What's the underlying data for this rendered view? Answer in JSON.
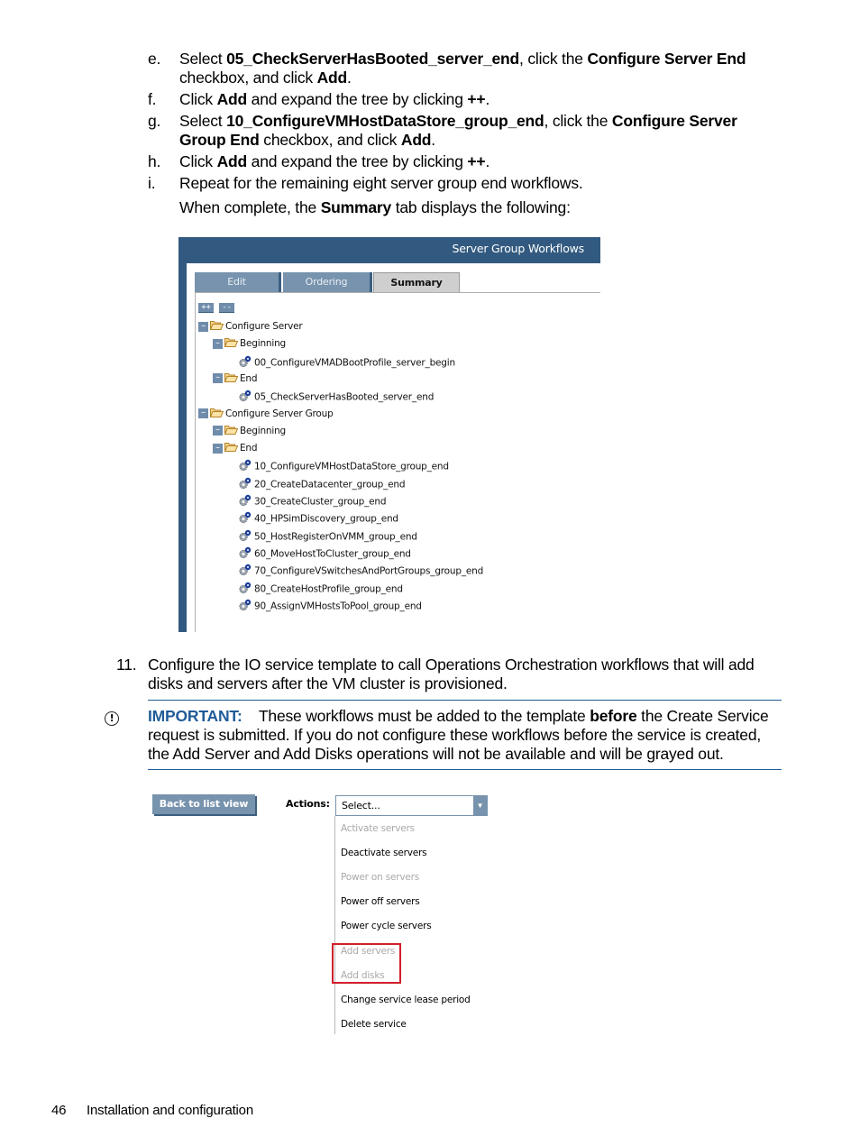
{
  "steps_top": [
    {
      "label": "e.",
      "parts": [
        [
          "Select ",
          false
        ],
        [
          "05_CheckServerHasBooted_server_end",
          true
        ],
        [
          ", click the ",
          false
        ],
        [
          "Configure Server End",
          true
        ],
        [
          "  checkbox, and click ",
          false
        ],
        [
          "Add",
          true
        ],
        [
          ".",
          false
        ]
      ]
    },
    {
      "label": "f.",
      "parts": [
        [
          "Click ",
          false
        ],
        [
          "Add",
          true
        ],
        [
          " and expand the tree by clicking ",
          false
        ],
        [
          "++",
          true
        ],
        [
          ".",
          false
        ]
      ]
    },
    {
      "label": "g.",
      "parts": [
        [
          "Select ",
          false
        ],
        [
          "10_ConfigureVMHostDataStore_group_end",
          true
        ],
        [
          ", click the ",
          false
        ],
        [
          "Configure Server Group End",
          true
        ],
        [
          " checkbox, and click ",
          false
        ],
        [
          "Add",
          true
        ],
        [
          ".",
          false
        ]
      ]
    },
    {
      "label": "h.",
      "parts": [
        [
          "Click ",
          false
        ],
        [
          "Add",
          true
        ],
        [
          " and expand the tree by clicking ",
          false
        ],
        [
          "++",
          true
        ],
        [
          ".",
          false
        ]
      ]
    },
    {
      "label": "i.",
      "parts": [
        [
          "Repeat for the remaining eight server group end workflows.",
          false
        ]
      ]
    }
  ],
  "summary_note": {
    "pre": "When complete, the ",
    "bold": "Summary",
    "post": " tab displays the following:"
  },
  "workflow_window": {
    "title": "Server Group Workflows",
    "tabs": [
      {
        "label": "Edit",
        "active": false
      },
      {
        "label": "Ordering",
        "active": false
      },
      {
        "label": "Summary",
        "active": true
      }
    ],
    "expand_all_label": "++",
    "collapse_all_label": "--",
    "tree": [
      {
        "level": 0,
        "type": "folder",
        "label": "Configure Server"
      },
      {
        "level": 1,
        "type": "folder",
        "label": "Beginning"
      },
      {
        "level": 2,
        "type": "workflow",
        "label": "00_ConfigureVMADBootProfile_server_begin"
      },
      {
        "level": 1,
        "type": "folder",
        "label": "End"
      },
      {
        "level": 2,
        "type": "workflow",
        "label": "05_CheckServerHasBooted_server_end"
      },
      {
        "level": 0,
        "type": "folder",
        "label": "Configure Server Group"
      },
      {
        "level": 1,
        "type": "folder",
        "label": "Beginning"
      },
      {
        "level": 1,
        "type": "folder",
        "label": "End"
      },
      {
        "level": 2,
        "type": "workflow",
        "label": "10_ConfigureVMHostDataStore_group_end"
      },
      {
        "level": 2,
        "type": "workflow",
        "label": "20_CreateDatacenter_group_end"
      },
      {
        "level": 2,
        "type": "workflow",
        "label": "30_CreateCluster_group_end"
      },
      {
        "level": 2,
        "type": "workflow",
        "label": "40_HPSimDiscovery_group_end"
      },
      {
        "level": 2,
        "type": "workflow",
        "label": "50_HostRegisterOnVMM_group_end"
      },
      {
        "level": 2,
        "type": "workflow",
        "label": "60_MoveHostToCluster_group_end"
      },
      {
        "level": 2,
        "type": "workflow",
        "label": "70_ConfigureVSwitchesAndPortGroups_group_end"
      },
      {
        "level": 2,
        "type": "workflow",
        "label": "80_CreateHostProfile_group_end"
      },
      {
        "level": 2,
        "type": "workflow",
        "label": "90_AssignVMHostsToPool_group_end"
      }
    ]
  },
  "step11": {
    "label": "11.",
    "text": "Configure the IO service template to call Operations Orchestration workflows that will add disks and servers after the VM cluster is provisioned."
  },
  "important": {
    "icon": "exclamation-circle-icon",
    "label": "IMPORTANT:",
    "pre": "    These workflows must be added to the template ",
    "bold": "before",
    "post": " the Create Service request is submitted. If you do not configure these workflows before the service is created, the Add Server and Add Disks operations will not be available and will be grayed out."
  },
  "service_actions": {
    "back_button": "Back to list view",
    "actions_label": "Actions:",
    "select_value": "Select...",
    "options": [
      {
        "label": "Activate servers",
        "enabled": false
      },
      {
        "label": "Deactivate servers",
        "enabled": true
      },
      {
        "label": "Power on servers",
        "enabled": false
      },
      {
        "label": "Power off servers",
        "enabled": true
      },
      {
        "label": "Power cycle servers",
        "enabled": true
      },
      {
        "label": "Add servers",
        "enabled": false,
        "highlighted": true
      },
      {
        "label": "Add disks",
        "enabled": false,
        "highlighted": true
      },
      {
        "label": "Change service lease period",
        "enabled": true
      },
      {
        "label": "Delete service",
        "enabled": true
      }
    ],
    "highlight_color": "#d11f2a"
  },
  "footer": {
    "page_number": "46",
    "section": "Installation and configuration"
  },
  "colors": {
    "header_blue": "#325a80",
    "important_blue": "#1f5c99",
    "tab_inactive": "#7793ad"
  }
}
